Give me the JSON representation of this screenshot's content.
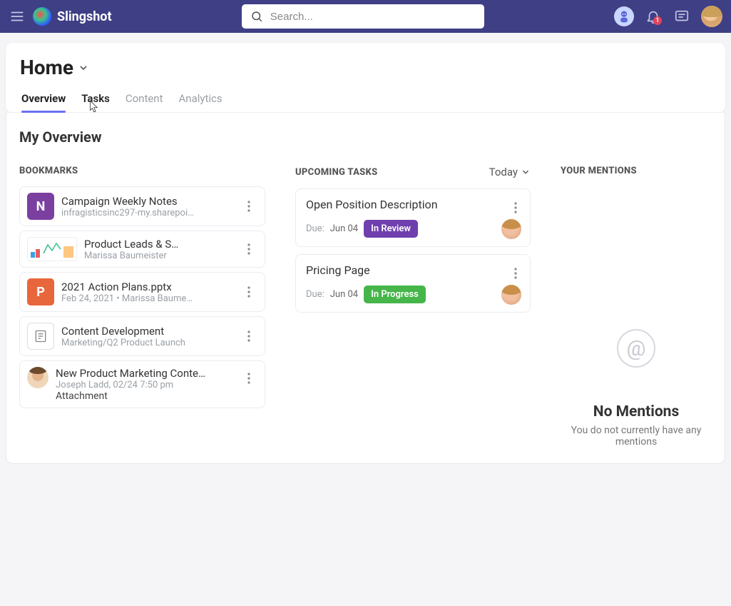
{
  "header": {
    "brand": "Slingshot",
    "search_placeholder": "Search...",
    "notification_badge": "1"
  },
  "page": {
    "title": "Home"
  },
  "tabs": [
    {
      "label": "Overview",
      "state": "active"
    },
    {
      "label": "Tasks",
      "state": "hover"
    },
    {
      "label": "Content",
      "state": ""
    },
    {
      "label": "Analytics",
      "state": ""
    }
  ],
  "main": {
    "section_title": "My Overview"
  },
  "bookmarks": {
    "header": "BOOKMARKS",
    "items": [
      {
        "icon_bg": "#7b3fa0",
        "icon_letter": "N",
        "title": "Campaign Weekly Notes",
        "sub": "infragisticsinc297-my.sharepoi…",
        "type": "onenote"
      },
      {
        "icon_bg": "#ffffff",
        "icon_letter": "",
        "title": "Product Leads & S…",
        "sub": "Marissa Baumeister",
        "type": "chart"
      },
      {
        "icon_bg": "#e8663c",
        "icon_letter": "P",
        "title": "2021 Action Plans.pptx",
        "sub": "Feb 24, 2021 • Marissa Baume…",
        "type": "ppt"
      },
      {
        "icon_bg": "#ffffff",
        "icon_letter": "",
        "title": "Content Development",
        "sub": "Marketing/Q2 Product Launch",
        "type": "doc"
      },
      {
        "icon_bg": "#ffffff",
        "icon_letter": "",
        "title": "New Product Marketing Conte…",
        "sub": "Joseph Ladd, 02/24 7:50 pm",
        "sub2": "Attachment",
        "type": "avatar"
      }
    ]
  },
  "tasks": {
    "header": "UPCOMING TASKS",
    "filter_label": "Today",
    "items": [
      {
        "title": "Open Position Description",
        "due_label": "Due:",
        "due_val": "Jun 04",
        "status": "In Review",
        "status_color": "#6f3fae"
      },
      {
        "title": "Pricing Page",
        "due_label": "Due:",
        "due_val": "Jun 04",
        "status": "In Progress",
        "status_color": "#46b54a"
      }
    ]
  },
  "mentions": {
    "header": "YOUR MENTIONS",
    "empty_title": "No Mentions",
    "empty_sub": "You do not currently have any mentions"
  }
}
